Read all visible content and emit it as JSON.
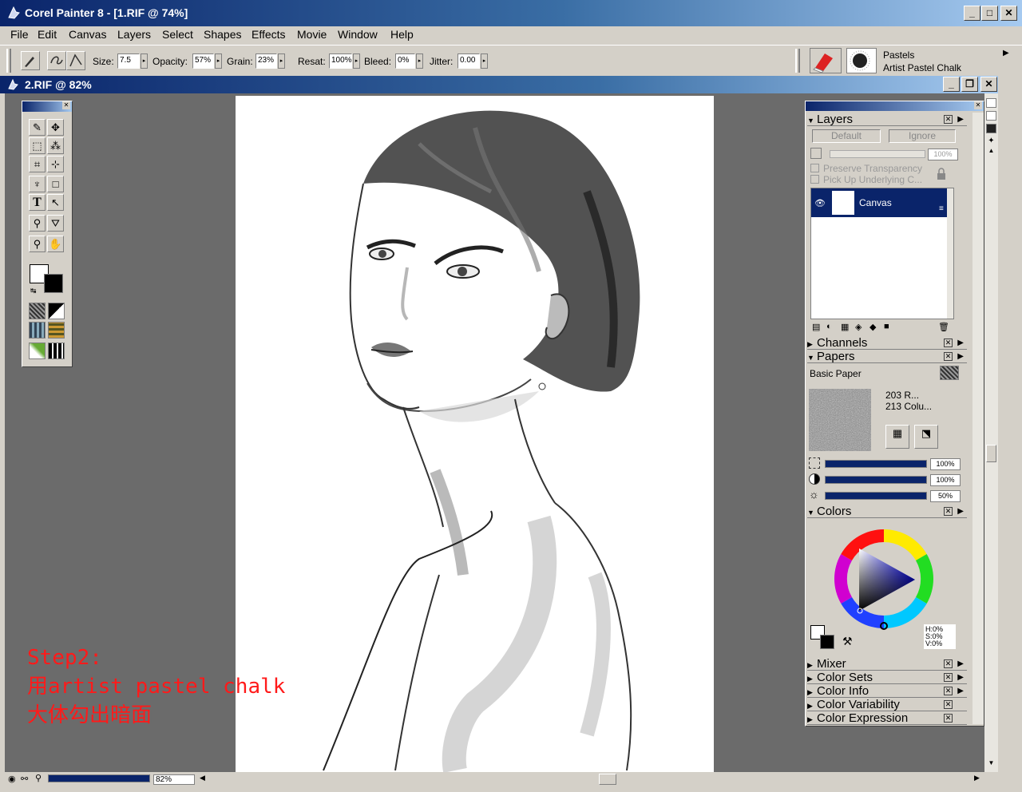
{
  "window": {
    "title": "Corel Painter 8 - [1.RIF @ 74%]"
  },
  "menu": [
    "File",
    "Edit",
    "Canvas",
    "Layers",
    "Select",
    "Shapes",
    "Effects",
    "Movie",
    "Window",
    "Help"
  ],
  "propbar": {
    "size_label": "Size:",
    "size_value": "7.5",
    "opacity_label": "Opacity:",
    "opacity_value": "57%",
    "grain_label": "Grain:",
    "grain_value": "23%",
    "resat_label": "Resat:",
    "resat_value": "100%",
    "bleed_label": "Bleed:",
    "bleed_value": "0%",
    "jitter_label": "Jitter:",
    "jitter_value": "0.00",
    "brush_category": "Pastels",
    "brush_variant": "Artist Pastel Chalk"
  },
  "document": {
    "title": "2.RIF @ 82%"
  },
  "layers": {
    "title": "Layers",
    "composite_method": "Default",
    "composite_depth": "Ignore",
    "opacity": "100%",
    "preserve_transparency": "Preserve Transparency",
    "pick_up_underlying": "Pick Up Underlying C...",
    "items": [
      {
        "name": "Canvas"
      }
    ]
  },
  "sections": {
    "channels": "Channels",
    "papers": "Papers",
    "colors": "Colors",
    "mixer": "Mixer",
    "color_sets": "Color Sets",
    "color_info": "Color Info",
    "color_variability": "Color Variability",
    "color_expression": "Color Expression"
  },
  "papers": {
    "selected": "Basic Paper",
    "scale_info": "203 R...",
    "contrast_info": "213 Colu...",
    "scale": "100%",
    "contrast": "100%",
    "brightness": "50%"
  },
  "colors": {
    "h": "H:0%",
    "s": "S:0%",
    "v": "V:0%"
  },
  "status": {
    "zoom": "82%"
  },
  "annotation": {
    "line1": "Step2:",
    "line2": "用artist pastel chalk",
    "line3": "大体勾出暗面"
  }
}
